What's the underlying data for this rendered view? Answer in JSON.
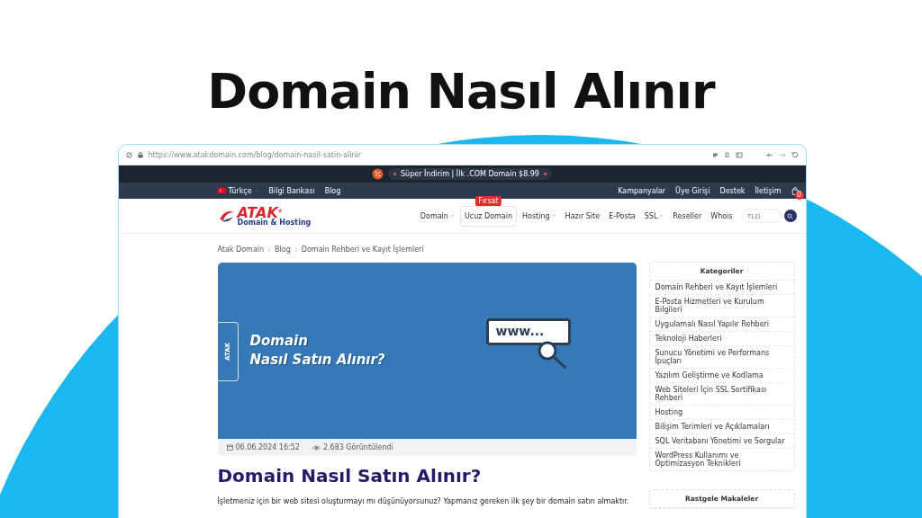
{
  "headline": "Domain Nasıl Alınır",
  "browser": {
    "url": "https://www.atakdomain.com/blog/domain-nasil-satin-alinir"
  },
  "announcement": {
    "text": "Süper İndirim | İlk .COM Domain $8.99"
  },
  "topbar": {
    "language": "Türkçe",
    "left": [
      "Bilgi Bankası",
      "Blog"
    ],
    "right": [
      "Kampanyalar",
      "Üye Girişi",
      "Destek",
      "İletişim"
    ],
    "cart_count": "0"
  },
  "logo": {
    "name": "ATAK$^{®}$",
    "tagline": "Domain & Hosting"
  },
  "nav": [
    {
      "label": "Domain",
      "dropdown": true
    },
    {
      "label": "Ucuz Domain",
      "dropdown": false,
      "badge": "Fırsat"
    },
    {
      "label": "Hosting",
      "dropdown": true
    },
    {
      "label": "Hazır Site",
      "dropdown": false
    },
    {
      "label": "E-Posta",
      "dropdown": false
    },
    {
      "label": "SSL",
      "dropdown": true
    },
    {
      "label": "Reseller",
      "dropdown": false
    },
    {
      "label": "Whois",
      "dropdown": false
    }
  ],
  "search": {
    "placeholder": "TLD"
  },
  "breadcrumb": [
    "Atak Domain",
    "Blog",
    "Domain Rehberi ve Kayıt İşlemleri"
  ],
  "article": {
    "banner": {
      "logo_text": "ATAK",
      "line1": "Domain",
      "line2": "Nasıl Satın Alınır?",
      "address": "www..."
    },
    "date": "06.06.2024 16:52",
    "views": "2.683 Görüntülendi",
    "title": "Domain Nasıl Satın Alınır?",
    "intro": "İşletmeniz için bir web sitesi oluşturmayı mı düşünüyorsunuz? Yapmanız gereken ilk şey bir domain satın almaktır."
  },
  "sidebar": {
    "categories_title": "Kategoriler",
    "categories": [
      "Domain Rehberi ve Kayıt İşlemleri",
      "E-Posta Hizmetleri ve Kurulum Bilgileri",
      "Uygulamalı Nasıl Yapılır Rehberi",
      "Teknoloji Haberleri",
      "Sunucu Yönetimi ve Performans İpuçları",
      "Yazılım Geliştirme ve Kodlama",
      "Web Siteleri İçin SSL Sertifikası Rehberi",
      "Hosting",
      "Bilişim Terimleri ve Açıklamaları",
      "SQL Veritabanı Yönetimi ve Sorgular",
      "WordPress Kullanımı ve Optimizasyon Teknikleri"
    ],
    "random_title": "Rastgele Makaleler"
  }
}
